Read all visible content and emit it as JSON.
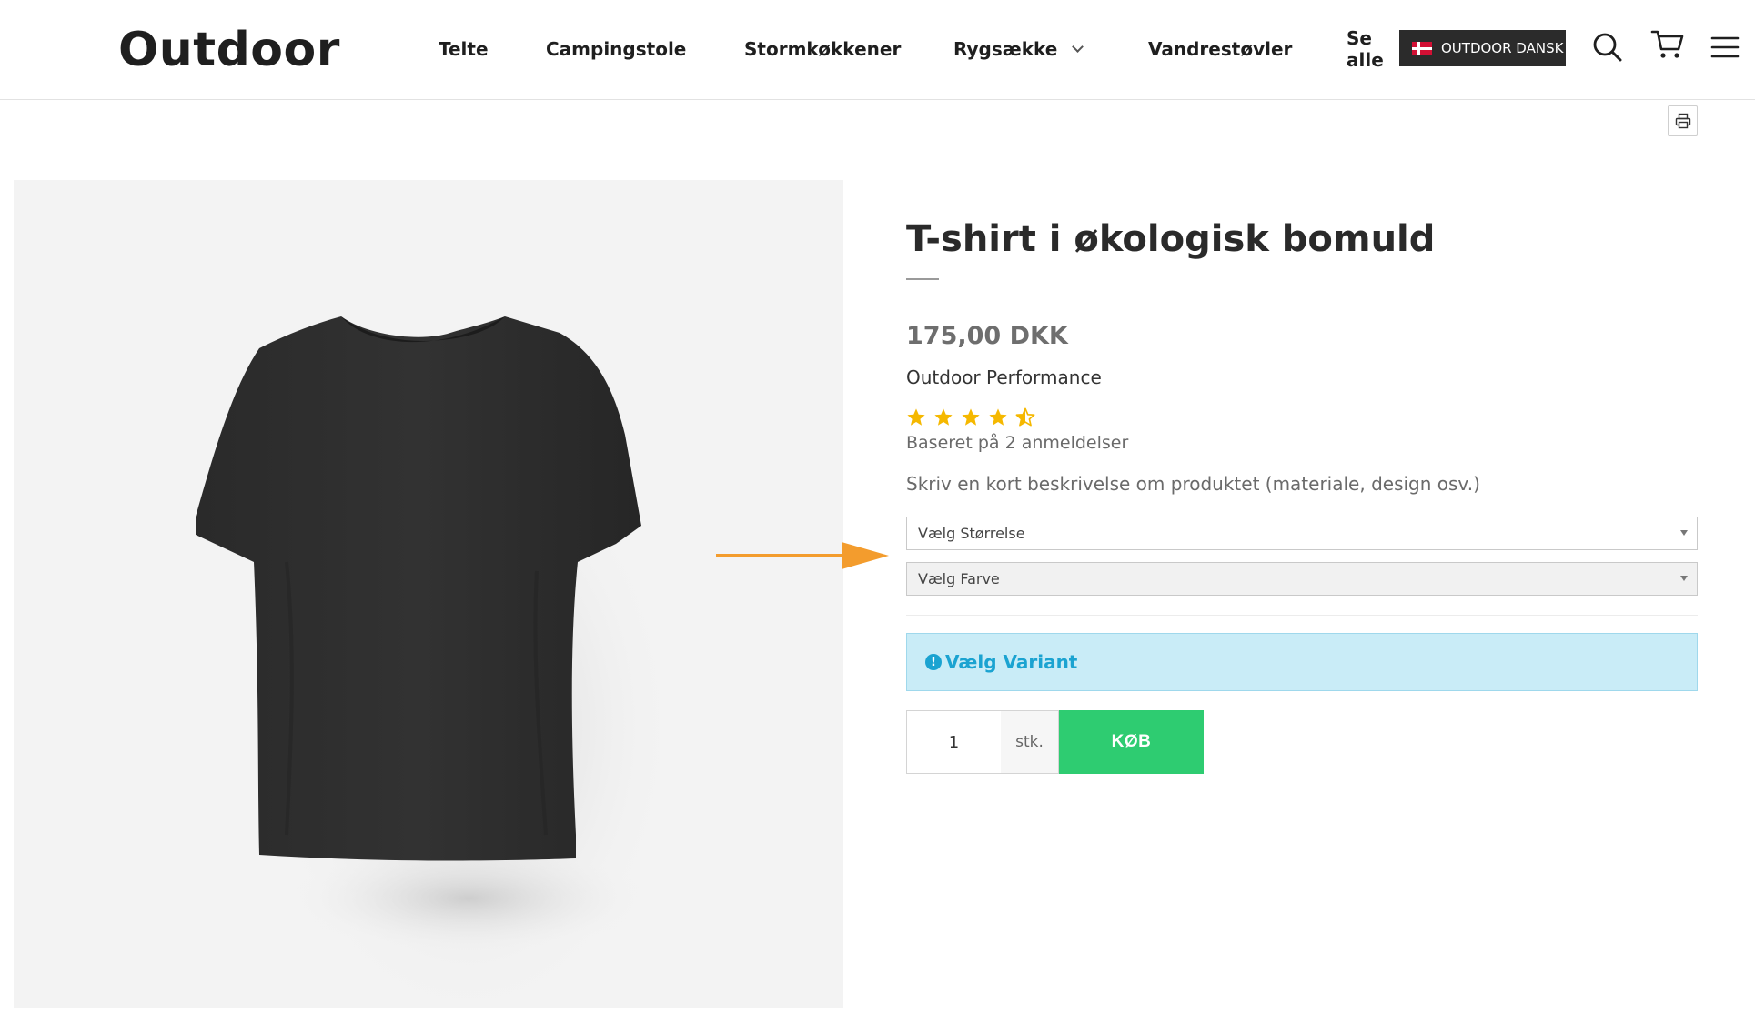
{
  "header": {
    "logo": "Outdoor",
    "nav": [
      {
        "label": "Telte"
      },
      {
        "label": "Campingstole"
      },
      {
        "label": "Stormkøkkener"
      },
      {
        "label": "Rygsække"
      },
      {
        "label": "Vandrestøvler"
      }
    ],
    "see_all": "Se alle",
    "language_button": "OUTDOOR DANSK",
    "icons": [
      "search-icon",
      "cart-icon",
      "hamburger-menu-icon"
    ]
  },
  "toolbar": {
    "print_icon": "printer-icon"
  },
  "product": {
    "title": "T-shirt i økologisk bomuld",
    "price": "175,00 DKK",
    "brand": "Outdoor Performance",
    "rating": {
      "stars": 4.5,
      "max": 5,
      "reviews_text": "Baseret på 2 anmeldelser",
      "color": "#f5b800"
    },
    "description": "Skriv en kort beskrivelse om produktet (materiale, design osv.)",
    "size_select": "Vælg Størrelse",
    "color_select": "Vælg Farve",
    "alert": "Vælg Variant",
    "alert_icon_glyph": "!",
    "quantity": "1",
    "unit": "stk.",
    "buy_label": "KØB"
  },
  "colors": {
    "buy_button": "#2ecc71",
    "alert_bg": "#c9ecf7",
    "alert_text": "#1ba3d1",
    "arrow": "#f39c2d",
    "language_button_bg": "#2b2b2b"
  }
}
